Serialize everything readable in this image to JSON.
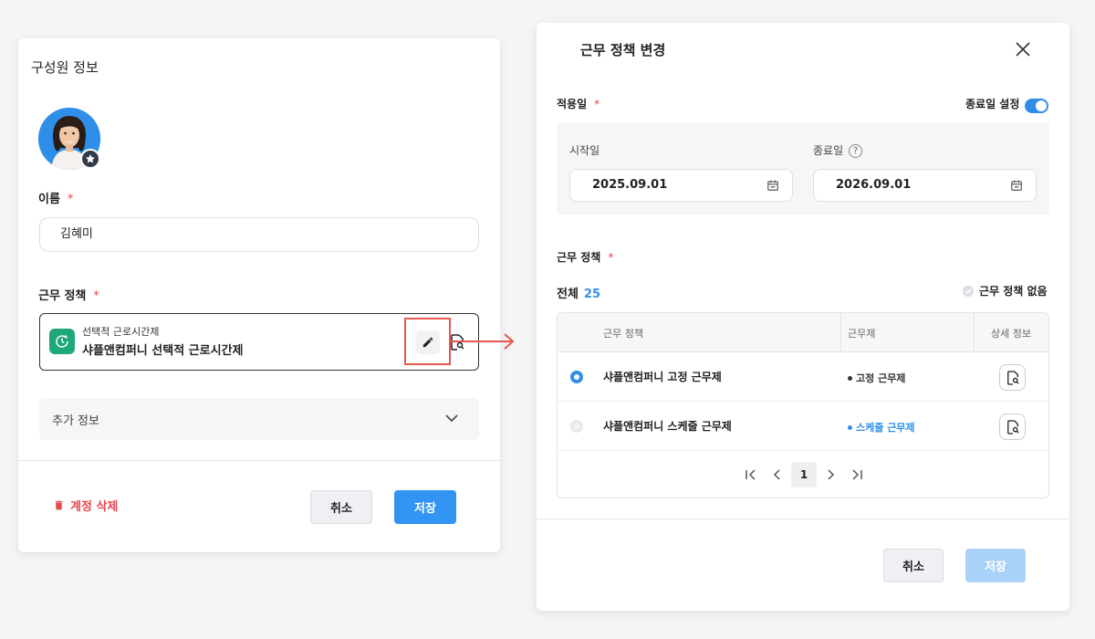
{
  "left_panel": {
    "title": "구성원 정보",
    "name_label": "이름",
    "required_mark": "*",
    "name_value": "김혜미",
    "policy_label": "근무 정책",
    "policy_sub": "선택적 근로시간제",
    "policy_main": "샤플앤컴퍼니 선택적 근로시간제",
    "extra_info": "추가 정보",
    "delete_label": "계정 삭제",
    "cancel_label": "취소",
    "save_label": "저장"
  },
  "modal": {
    "title": "근무 정책 변경",
    "apply_date_label": "적용일",
    "end_date_toggle_label": "종료일 설정",
    "end_date_toggle_on": true,
    "start_label": "시작일",
    "start_value": "2025.09.01",
    "end_label": "종료일",
    "end_value": "2026.09.01",
    "policy_label": "근무 정책",
    "total_label": "전체",
    "total_count": "25",
    "no_policy_label": "근무 정책 없음",
    "table": {
      "columns": [
        "근무 정책",
        "근무제",
        "상세 정보"
      ],
      "rows": [
        {
          "name": "샤플앤컴퍼니 고정 근무제",
          "type": "고정 근무제",
          "selected": true,
          "type_color": "#333333"
        },
        {
          "name": "샤플앤컴퍼니 스케줄 근무제",
          "type": "스케줄 근무제",
          "selected": false,
          "type_color": "#2f8fe8"
        }
      ]
    },
    "pagination": {
      "current": "1"
    },
    "cancel_label": "취소",
    "save_label": "저장"
  },
  "colors": {
    "accent": "#2f8fe8",
    "danger": "#e5484d",
    "policy_icon_bg": "#1ea77a",
    "highlight": "#e8584f"
  }
}
